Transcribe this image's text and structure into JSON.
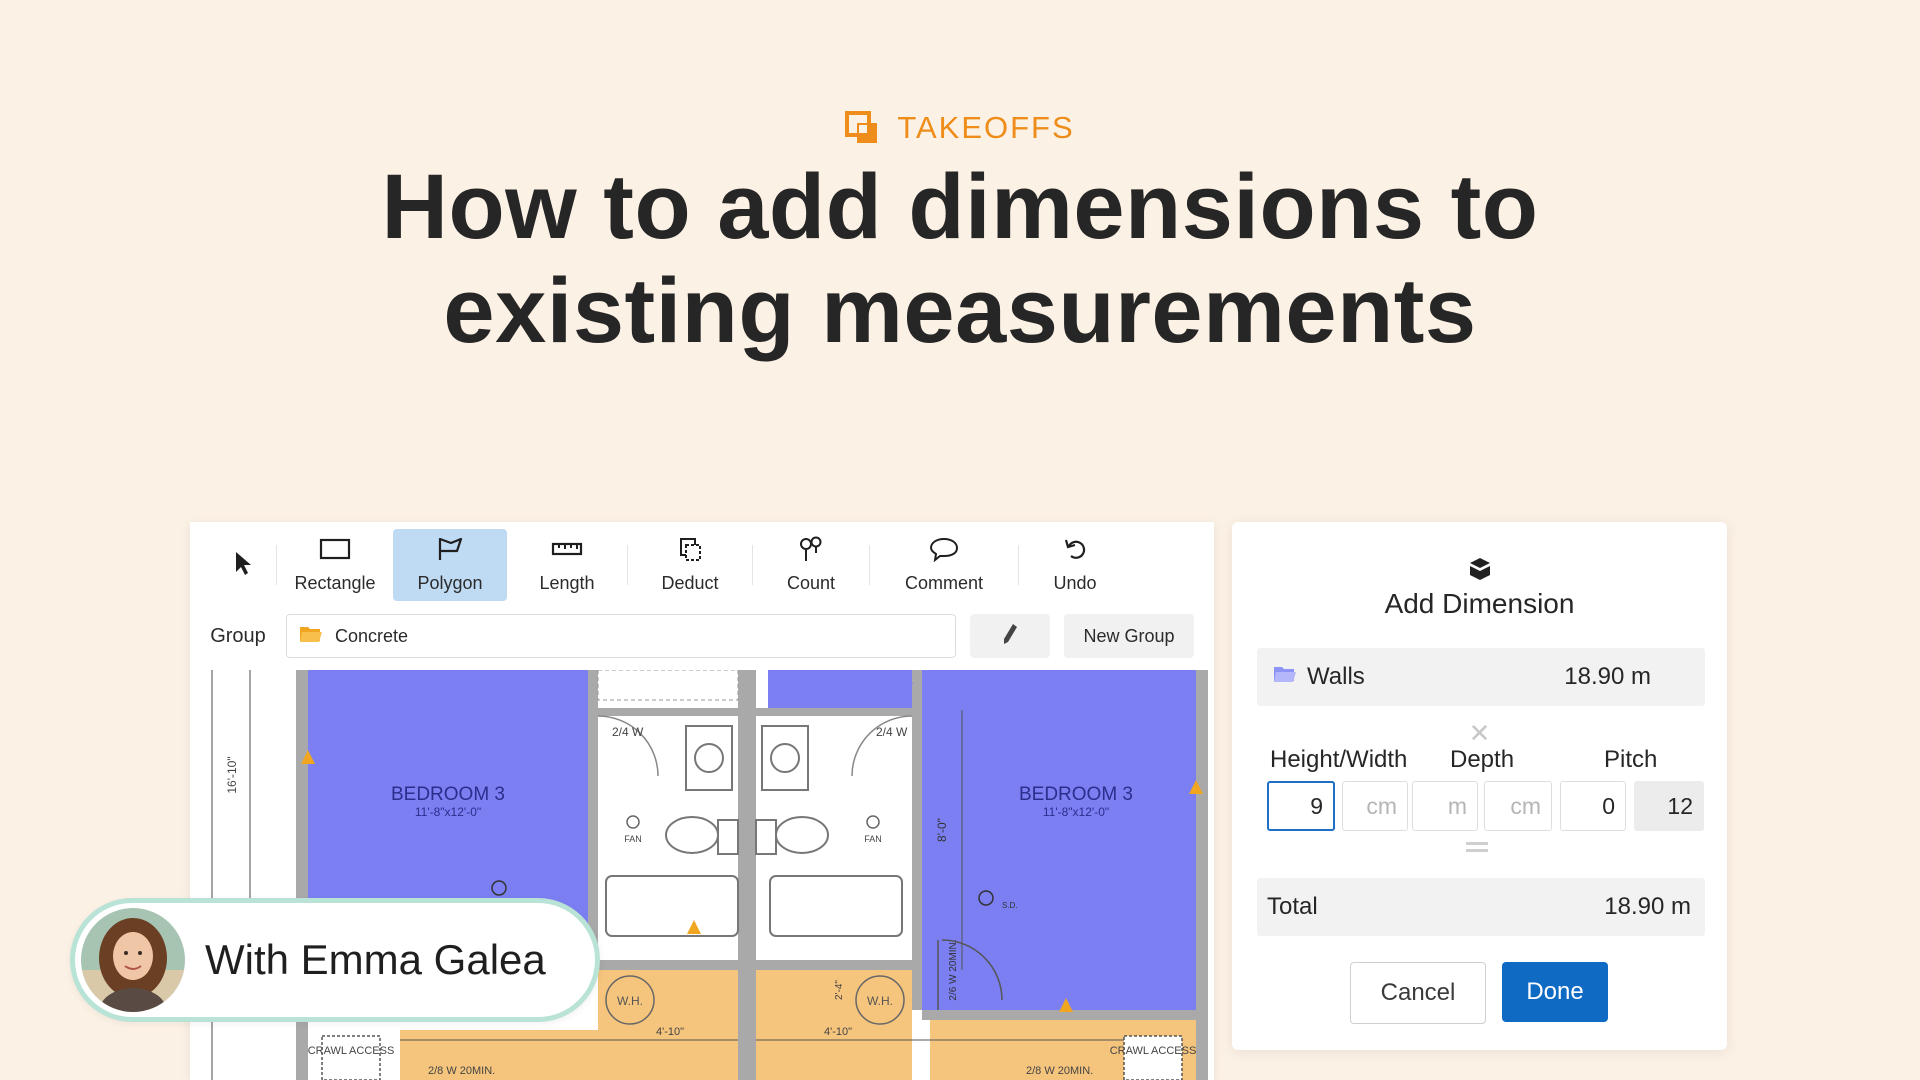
{
  "eyebrow": {
    "label": "TAKEOFFS"
  },
  "headline": {
    "line1": "How to add dimensions to",
    "line2": "existing measurements"
  },
  "toolbar": {
    "tools": [
      {
        "label": "",
        "icon": "pointer-icon"
      },
      {
        "label": "Rectangle",
        "icon": "rectangle-icon"
      },
      {
        "label": "Polygon",
        "icon": "polygon-icon",
        "active": true
      },
      {
        "label": "Length",
        "icon": "ruler-icon"
      },
      {
        "label": "Deduct",
        "icon": "deduct-icon"
      },
      {
        "label": "Count",
        "icon": "count-icon"
      },
      {
        "label": "Comment",
        "icon": "comment-icon"
      },
      {
        "label": "Undo",
        "icon": "undo-icon"
      }
    ]
  },
  "group": {
    "label": "Group",
    "selected": "Concrete",
    "new_group": "New Group"
  },
  "plan": {
    "bedroom_left": "BEDROOM 3",
    "bedroom_left_size": "11'-8\"x12'-0\"",
    "bedroom_right": "BEDROOM 3",
    "bedroom_right_size": "11'-8\"x12'-0\"",
    "dim_vertical": "16'-10\"",
    "dim_mid": "8'-0\"",
    "wall_left": "2/4 W",
    "wall_right": "2/4 W",
    "fan_left": "FAN",
    "fan_right": "FAN",
    "wh_left": "W.H.",
    "wh_right": "W.H.",
    "dim_bottom_left": "4'-10\"",
    "dim_bottom_right": "4'-10\"",
    "crawl_left": "CRAWL ACCESS",
    "crawl_right": "CRAWL ACCESS",
    "door_left": "2/8 W 20MIN.",
    "door_right": "2/8 W 20MIN.",
    "door_vertical": "2/6 W 20MIN.",
    "sd": "S.D.",
    "small_dim": "2'-4\""
  },
  "presenter": {
    "name": "With Emma Galea"
  },
  "dialog": {
    "title": "Add Dimension",
    "walls_label": "Walls",
    "walls_value": "18.90 m",
    "height_width_label": "Height/Width",
    "depth_label": "Depth",
    "pitch_label": "Pitch",
    "height_value": "9",
    "height_unit_placeholder": "cm",
    "depth_m_placeholder": "m",
    "depth_cm_placeholder": "cm",
    "pitch_rise": "0",
    "pitch_run": "12",
    "total_label": "Total",
    "total_value": "18.90 m",
    "cancel": "Cancel",
    "done": "Done"
  },
  "colors": {
    "background": "#fcf1e5",
    "accent_orange": "#ee8d19",
    "primary_blue": "#0f6ac4",
    "room_blue": "#7b7ff2",
    "room_orange": "#f5c57e",
    "presenter_border": "#b9e3d6"
  }
}
